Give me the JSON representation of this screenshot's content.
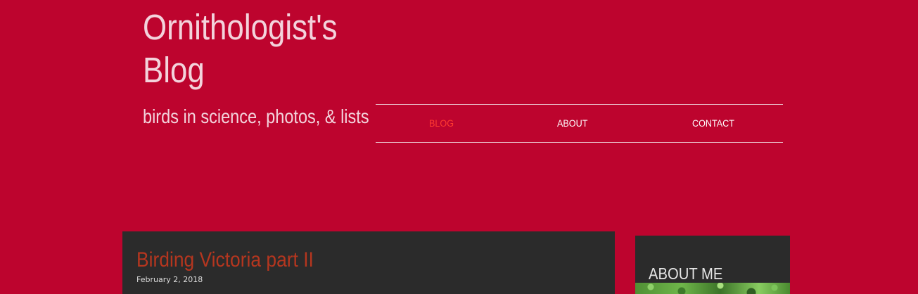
{
  "site": {
    "title": "Ornithologist's Blog",
    "tagline": "birds in science, photos, & lists"
  },
  "nav": {
    "items": [
      {
        "label": "BLOG",
        "active": true
      },
      {
        "label": "ABOUT",
        "active": false
      },
      {
        "label": "CONTACT",
        "active": false
      }
    ]
  },
  "post": {
    "title": "Birding Victoria part II",
    "date": "February 2, 2018"
  },
  "sidebar": {
    "heading": "ABOUT ME"
  },
  "colors": {
    "background": "#bd042e",
    "card": "#2b2b2b",
    "nav_active": "#ff3b30",
    "post_title": "#b5361f"
  }
}
